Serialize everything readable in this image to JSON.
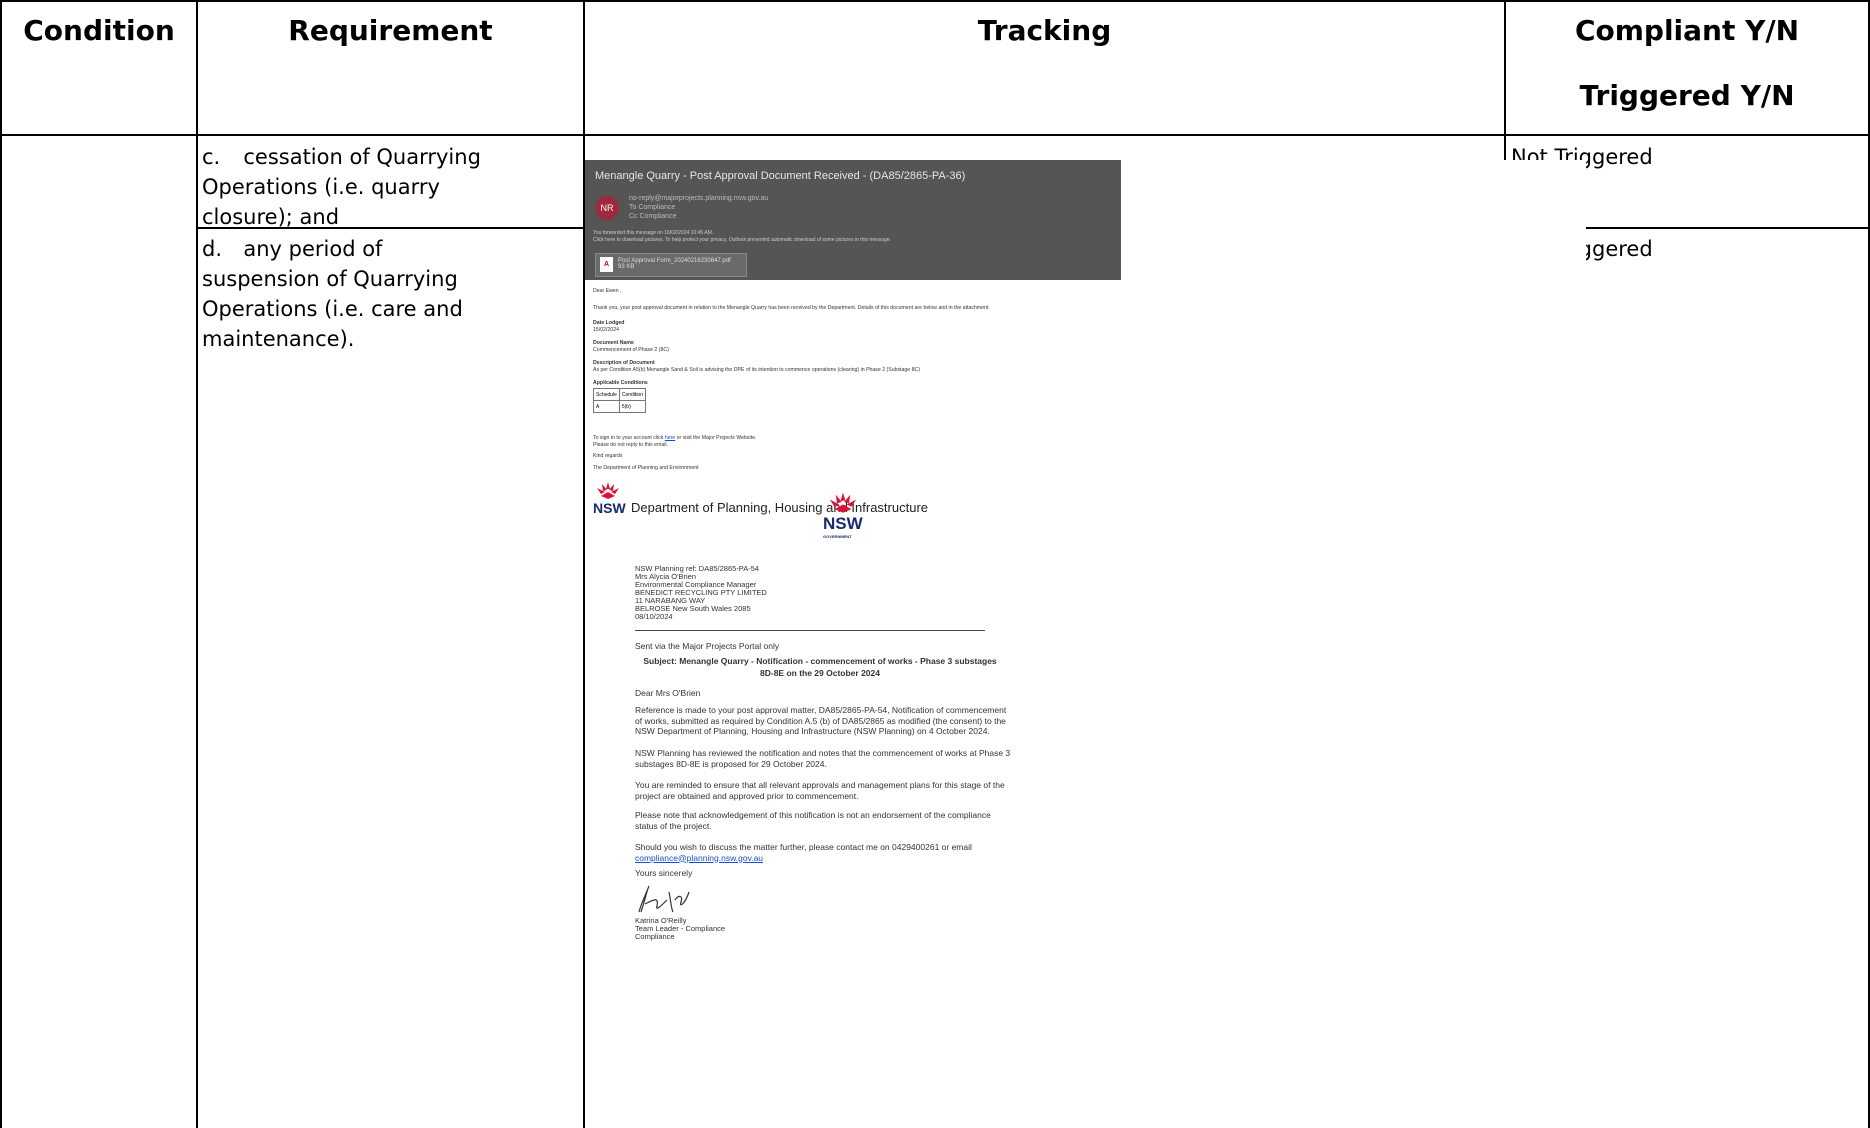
{
  "table": {
    "headers": {
      "condition": "Condition",
      "requirement": "Requirement",
      "tracking": "Tracking",
      "compliant": "Compliant Y/N",
      "triggered": "Triggered Y/N"
    },
    "rows": [
      {
        "letter": "c.",
        "lines": [
          "cessation of Quarrying",
          "Operations (i.e. quarry",
          "closure); and"
        ],
        "status": "Not Triggered"
      },
      {
        "letter": "d.",
        "lines": [
          "any period of",
          "suspension of Quarrying",
          "Operations (i.e. care and",
          "maintenance)."
        ],
        "status": "Not Triggered"
      }
    ]
  },
  "email": {
    "subject": "Menangle Quarry - Post Approval Document Received - (DA85/2865-PA-36)",
    "avatar": "NR",
    "from": "no-reply@majorprojects.planning.nsw.gov.au",
    "to": "To   Compliance",
    "cc": "Cc   Compliance",
    "info_line1": "You forwarded this message on 16/02/2024 10:45 AM.",
    "info_line2": "Click here to download pictures. To help protect your privacy, Outlook prevented automatic download of some pictures in this message.",
    "attachment_name": "Post Approval Form_20240216230847.pdf",
    "attachment_size": "93 KB",
    "greeting": "Dear Ewen ,",
    "intro": "Thank you, your post approval document in relation to the Menangle Quarry has been received by the Department. Details of this document are below and in the attachment.",
    "date_lodged_label": "Date Lodged",
    "date_lodged": "15/02/2024",
    "doc_name_label": "Document Name",
    "doc_name": "Commencement of Phase 2 (8C)",
    "desc_label": "Description of Document",
    "desc": "As per Condition A5(b) Menangle Sand & Soil is advising the DPE of its intention to commence operations (clearing) in Phase 2 (Substage 8C)",
    "applicable_label": "Applicable Conditions",
    "mini_headers": [
      "Schedule",
      "Condition"
    ],
    "mini_row": [
      "A",
      "5(b)"
    ],
    "signin_prefix": "To sign in to your account click",
    "signin_link": "here",
    "signin_suffix": "or visit the Major Projects Website.",
    "noreply": "Please do not reply to this email.",
    "regards": "Kind regards",
    "dept": "The Department of Planning and Environment",
    "nsw": "NSW"
  },
  "letter": {
    "department": "Department of Planning, Housing and Infrastructure",
    "nsw": "NSW",
    "government": "GOVERNMENT",
    "address_lines": [
      "NSW Planning ref: DA85/2865-PA-54",
      "Mrs Alycia O'Brien",
      "Environmental Compliance Manager",
      "BENEDICT RECYCLING PTY LIMITED",
      "11 NARABANG WAY",
      "BELROSE New South Wales 2085",
      "08/10/2024"
    ],
    "sent_via": "Sent via the Major Projects Portal only",
    "subject_line1": "Subject: Menangle Quarry - Notification - commencement of works - Phase 3 substages",
    "subject_line2": "8D-8E on the 29 October 2024",
    "salutation": "Dear Mrs O'Brien",
    "para1": [
      "Reference is made to your post approval matter, DA85/2865-PA-54, Notification of commencement",
      "of works, submitted as required by Condition A.5 (b) of DA85/2865 as modified (the consent) to the",
      "NSW Department of Planning, Housing and Infrastructure (NSW Planning) on 4 October 2024."
    ],
    "para2": [
      "NSW Planning has reviewed the notification and notes that the commencement of works at Phase 3",
      "substages 8D-8E is proposed for 29 October 2024."
    ],
    "para3": [
      "You are reminded to ensure that all relevant approvals and management plans for this stage of the",
      "project are obtained and approved prior to commencement."
    ],
    "para4": [
      "Please note that acknowledgement of this notification is not an endorsement of the compliance",
      "status of the project."
    ],
    "para5_line1": "Should you wish to discuss the matter further, please contact me on 0429400261 or email",
    "para5_email": "compliance@planning.nsw.gov.au",
    "closing": "Yours sincerely",
    "signatory_lines": [
      "Katrina O'Reilly",
      "Team Leader - Compliance",
      "Compliance"
    ]
  }
}
